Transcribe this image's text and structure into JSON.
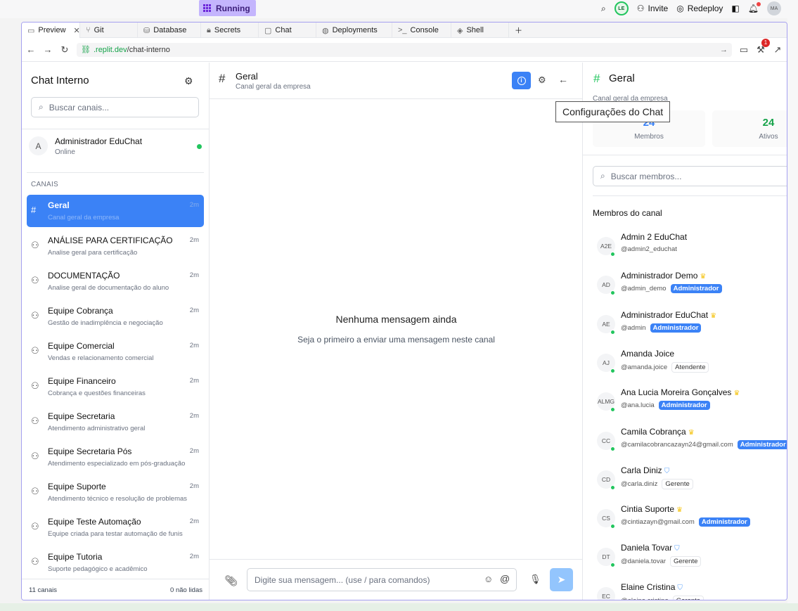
{
  "topbar": {
    "running_label": "Running",
    "invite_label": "Invite",
    "redeploy_label": "Redeploy",
    "user_initials": "LE",
    "account_initials": "MA",
    "notification_count": "1"
  },
  "tabs": [
    {
      "label": "Preview",
      "icon": "monitor-icon"
    },
    {
      "label": "Git",
      "icon": "git-icon"
    },
    {
      "label": "Database",
      "icon": "database-icon"
    },
    {
      "label": "Secrets",
      "icon": "lock-icon"
    },
    {
      "label": "Chat",
      "icon": "chat-icon"
    },
    {
      "label": "Deployments",
      "icon": "globe-icon"
    },
    {
      "label": "Console",
      "icon": "terminal-icon"
    },
    {
      "label": "Shell",
      "icon": "shell-icon"
    }
  ],
  "url": {
    "host": ".replit.dev",
    "path": "/chat-interno"
  },
  "sidebar": {
    "title": "Chat Interno",
    "search_placeholder": "Buscar canais...",
    "user": {
      "initial": "A",
      "name": "Administrador EduChat",
      "status": "Online"
    },
    "section_label": "CANAIS",
    "channels": [
      {
        "name": "Geral",
        "desc": "Canal geral da empresa",
        "time": "2m",
        "icon": "#"
      },
      {
        "name": "ANÁLISE PARA CERTIFICAÇÃO",
        "desc": "Analise geral para certificação",
        "time": "2m",
        "icon": "users"
      },
      {
        "name": "DOCUMENTAÇÃO",
        "desc": "Analise geral de documentação do aluno",
        "time": "2m",
        "icon": "users"
      },
      {
        "name": "Equipe Cobrança",
        "desc": "Gestão de inadimplência e negociação",
        "time": "2m",
        "icon": "users"
      },
      {
        "name": "Equipe Comercial",
        "desc": "Vendas e relacionamento comercial",
        "time": "2m",
        "icon": "users"
      },
      {
        "name": "Equipe Financeiro",
        "desc": "Cobrança e questões financeiras",
        "time": "2m",
        "icon": "users"
      },
      {
        "name": "Equipe Secretaria",
        "desc": "Atendimento administrativo geral",
        "time": "2m",
        "icon": "users"
      },
      {
        "name": "Equipe Secretaria Pós",
        "desc": "Atendimento especializado em pós-graduação",
        "time": "2m",
        "icon": "users"
      },
      {
        "name": "Equipe Suporte",
        "desc": "Atendimento técnico e resolução de problemas",
        "time": "2m",
        "icon": "users"
      },
      {
        "name": "Equipe Teste Automação",
        "desc": "Equipe criada para testar automação de funis",
        "time": "2m",
        "icon": "users"
      },
      {
        "name": "Equipe Tutoria",
        "desc": "Suporte pedagógico e acadêmico",
        "time": "2m",
        "icon": "users"
      }
    ],
    "footer_count": "11 canais",
    "footer_unread": "0 não lidas"
  },
  "center": {
    "title": "Geral",
    "subtitle": "Canal geral da empresa",
    "empty_title": "Nenhuma mensagem ainda",
    "empty_sub": "Seja o primeiro a enviar uma mensagem neste canal",
    "input_placeholder": "Digite sua mensagem... (use / para comandos)"
  },
  "tooltip": "Configurações do Chat",
  "right": {
    "title": "Geral",
    "subtitle": "Canal geral da empresa",
    "stats": [
      {
        "value": "24",
        "label": "Membros",
        "color": "#3b82f6"
      },
      {
        "value": "24",
        "label": "Ativos",
        "color": "#16a34a"
      }
    ],
    "search_placeholder": "Buscar membros...",
    "members_label": "Membros do canal",
    "members": [
      {
        "initials": "A2E",
        "name": "Admin 2 EduChat",
        "handle": "@admin2_educhat",
        "badge": "",
        "role": ""
      },
      {
        "initials": "AD",
        "name": "Administrador Demo",
        "handle": "@admin_demo",
        "badge": "crown",
        "role": "Administrador"
      },
      {
        "initials": "AE",
        "name": "Administrador EduChat",
        "handle": "@admin",
        "badge": "crown",
        "role": "Administrador"
      },
      {
        "initials": "AJ",
        "name": "Amanda Joice",
        "handle": "@amanda.joice",
        "badge": "",
        "role": "Atendente"
      },
      {
        "initials": "ALMG",
        "name": "Ana Lucia Moreira Gonçalves",
        "handle": "@ana.lucia",
        "badge": "crown",
        "role": "Administrador"
      },
      {
        "initials": "CC",
        "name": "Camila Cobrança",
        "handle": "@camilacobrancazayn24@gmail.com",
        "badge": "crown",
        "role": "Administrador"
      },
      {
        "initials": "CD",
        "name": "Carla Diniz",
        "handle": "@carla.diniz",
        "badge": "shield",
        "role": "Gerente"
      },
      {
        "initials": "CS",
        "name": "Cintia Suporte",
        "handle": "@cintiazayn@gmail.com",
        "badge": "crown",
        "role": "Administrador"
      },
      {
        "initials": "DT",
        "name": "Daniela Tovar",
        "handle": "@daniela.tovar",
        "badge": "shield",
        "role": "Gerente"
      },
      {
        "initials": "EC",
        "name": "Elaine Cristina",
        "handle": "@elaine.cristina",
        "badge": "shield",
        "role": "Gerente"
      }
    ]
  }
}
